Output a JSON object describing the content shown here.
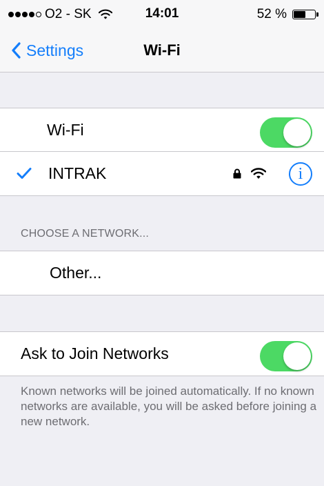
{
  "status_bar": {
    "carrier": "O2 - SK",
    "signal_strength": 4,
    "signal_max": 5,
    "time": "14:01",
    "battery_text": "52 %",
    "battery_level": 0.52
  },
  "nav": {
    "back_label": "Settings",
    "title": "Wi-Fi"
  },
  "wifi": {
    "label": "Wi-Fi",
    "enabled": true
  },
  "connected_network": {
    "name": "INTRAK",
    "secured": true,
    "info_glyph": "i"
  },
  "choose_network": {
    "header": "CHOOSE A NETWORK...",
    "other_label": "Other..."
  },
  "ask_to_join": {
    "label": "Ask to Join Networks",
    "enabled": true,
    "footer": "Known networks will be joined automatically. If no known networks are available, you will be asked before joining a new network."
  },
  "colors": {
    "accent": "#147efb",
    "toggle_on": "#4cd964",
    "background": "#efeff4",
    "secondary_text": "#6d6d72"
  },
  "icons": {
    "back": "chevron-left-icon",
    "check": "checkmark-icon",
    "lock": "lock-icon",
    "wifi": "wifi-icon",
    "info": "info-icon"
  }
}
